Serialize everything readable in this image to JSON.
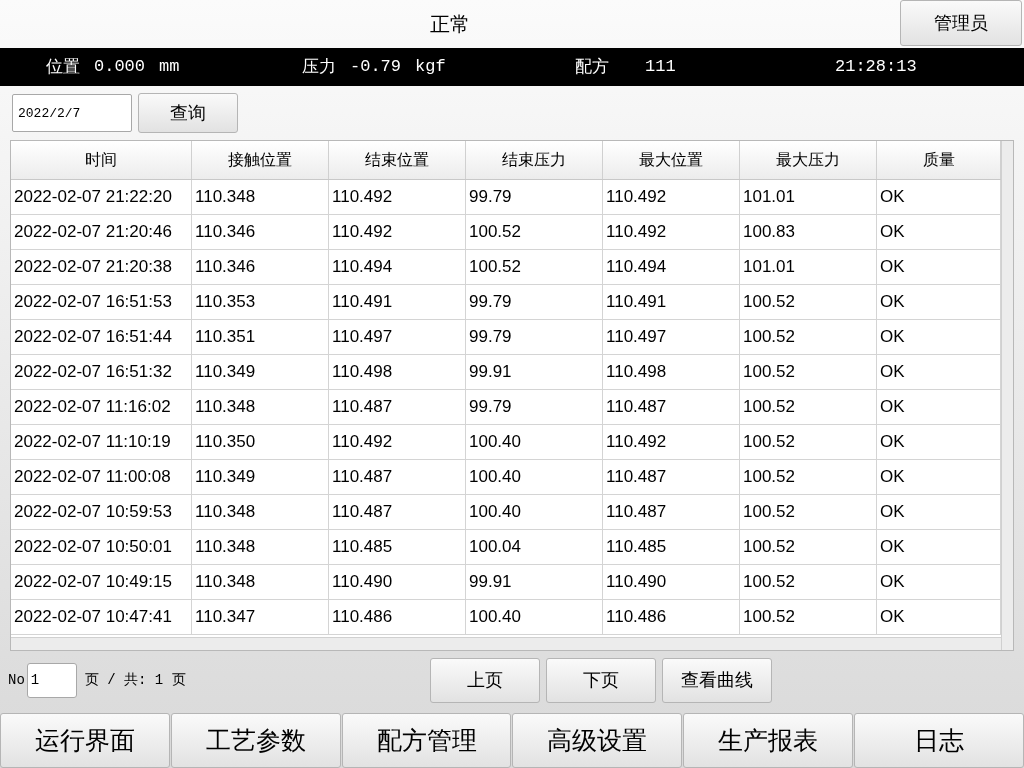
{
  "header": {
    "title": "正常",
    "user_button": "管理员"
  },
  "status_bar": [
    {
      "label": "位置",
      "value": "0.000",
      "unit": "mm"
    },
    {
      "label": "压力",
      "value": "-0.79",
      "unit": "kgf"
    },
    {
      "label": "配方",
      "value": "111"
    }
  ],
  "status_time": "21:28:13",
  "query": {
    "date": "2022/2/7",
    "button": "查询"
  },
  "table": {
    "columns": [
      "时间",
      "接触位置",
      "结束位置",
      "结束压力",
      "最大位置",
      "最大压力",
      "质量"
    ],
    "rows": [
      [
        "2022-02-07 21:22:20",
        "110.348",
        "110.492",
        "99.79",
        "110.492",
        "101.01",
        "OK"
      ],
      [
        "2022-02-07 21:20:46",
        "110.346",
        "110.492",
        "100.52",
        "110.492",
        "100.83",
        "OK"
      ],
      [
        "2022-02-07 21:20:38",
        "110.346",
        "110.494",
        "100.52",
        "110.494",
        "101.01",
        "OK"
      ],
      [
        "2022-02-07 16:51:53",
        "110.353",
        "110.491",
        "99.79",
        "110.491",
        "100.52",
        "OK"
      ],
      [
        "2022-02-07 16:51:44",
        "110.351",
        "110.497",
        "99.79",
        "110.497",
        "100.52",
        "OK"
      ],
      [
        "2022-02-07 16:51:32",
        "110.349",
        "110.498",
        "99.91",
        "110.498",
        "100.52",
        "OK"
      ],
      [
        "2022-02-07 11:16:02",
        "110.348",
        "110.487",
        "99.79",
        "110.487",
        "100.52",
        "OK"
      ],
      [
        "2022-02-07 11:10:19",
        "110.350",
        "110.492",
        "100.40",
        "110.492",
        "100.52",
        "OK"
      ],
      [
        "2022-02-07 11:00:08",
        "110.349",
        "110.487",
        "100.40",
        "110.487",
        "100.52",
        "OK"
      ],
      [
        "2022-02-07 10:59:53",
        "110.348",
        "110.487",
        "100.40",
        "110.487",
        "100.52",
        "OK"
      ],
      [
        "2022-02-07 10:50:01",
        "110.348",
        "110.485",
        "100.04",
        "110.485",
        "100.52",
        "OK"
      ],
      [
        "2022-02-07 10:49:15",
        "110.348",
        "110.490",
        "99.91",
        "110.490",
        "100.52",
        "OK"
      ],
      [
        "2022-02-07 10:47:41",
        "110.347",
        "110.486",
        "100.40",
        "110.486",
        "100.52",
        "OK"
      ]
    ]
  },
  "pagination": {
    "no_label": "No",
    "page": "1",
    "total": "页 / 共: 1 页",
    "buttons": [
      "上页",
      "下页",
      "查看曲线"
    ]
  },
  "nav_tabs": [
    "运行界面",
    "工艺参数",
    "配方管理",
    "高级设置",
    "生产报表",
    "日志"
  ]
}
